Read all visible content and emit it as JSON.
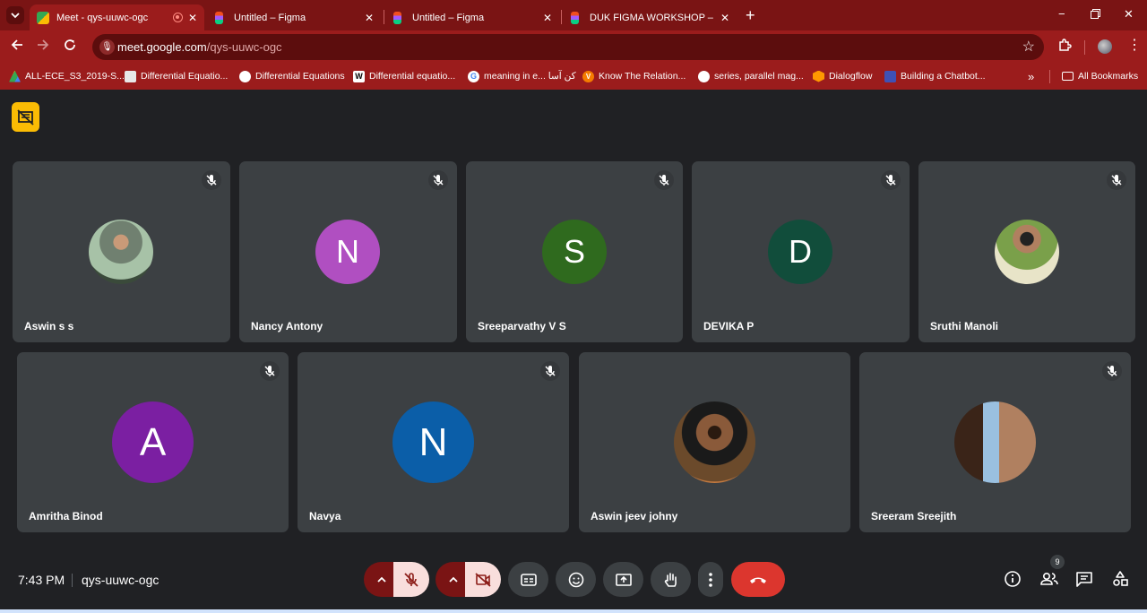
{
  "browser": {
    "tabs": [
      {
        "title": "Meet - qys-uuwc-ogc"
      },
      {
        "title": "Untitled – Figma"
      },
      {
        "title": "Untitled – Figma"
      },
      {
        "title": "DUK FIGMA WORKSHOP – Figma"
      }
    ],
    "url_host": "meet.google.com",
    "url_path": "/qys-uuwc-ogc",
    "bookmarks": [
      {
        "label": "ALL-ECE_S3_2019-S..."
      },
      {
        "label": "Differential Equatio..."
      },
      {
        "label": "Differential Equations"
      },
      {
        "label": "Differential equatio..."
      },
      {
        "label": "meaning in e... کن آسا"
      },
      {
        "label": "Know The Relation..."
      },
      {
        "label": "series, parallel mag..."
      },
      {
        "label": "Dialogflow"
      },
      {
        "label": "Building a Chatbot..."
      }
    ],
    "more_bookmarks": "»",
    "all_bookmarks": "All Bookmarks"
  },
  "participants": [
    {
      "name": "Aswin s s",
      "initial": "",
      "color": "#5a6a5a"
    },
    {
      "name": "Nancy Antony",
      "initial": "N",
      "color": "#b04fc1"
    },
    {
      "name": "Sreeparvathy V S",
      "initial": "S",
      "color": "#2f6a1e"
    },
    {
      "name": "DEVIKA P",
      "initial": "D",
      "color": "#114d3b"
    },
    {
      "name": "Sruthi Manoli",
      "initial": "",
      "color": "#c9c59a"
    },
    {
      "name": "Amritha Binod",
      "initial": "A",
      "color": "#7b1fa2"
    },
    {
      "name": "Navya",
      "initial": "N",
      "color": "#0b5ea8"
    },
    {
      "name": "Aswin jeev johny",
      "initial": "",
      "color": "#6b4a2b"
    },
    {
      "name": "Sreeram Sreejith",
      "initial": "",
      "color": "#8a6a4a"
    }
  ],
  "meeting": {
    "time": "7:43 PM",
    "code": "qys-uuwc-ogc",
    "participant_count": "9"
  }
}
